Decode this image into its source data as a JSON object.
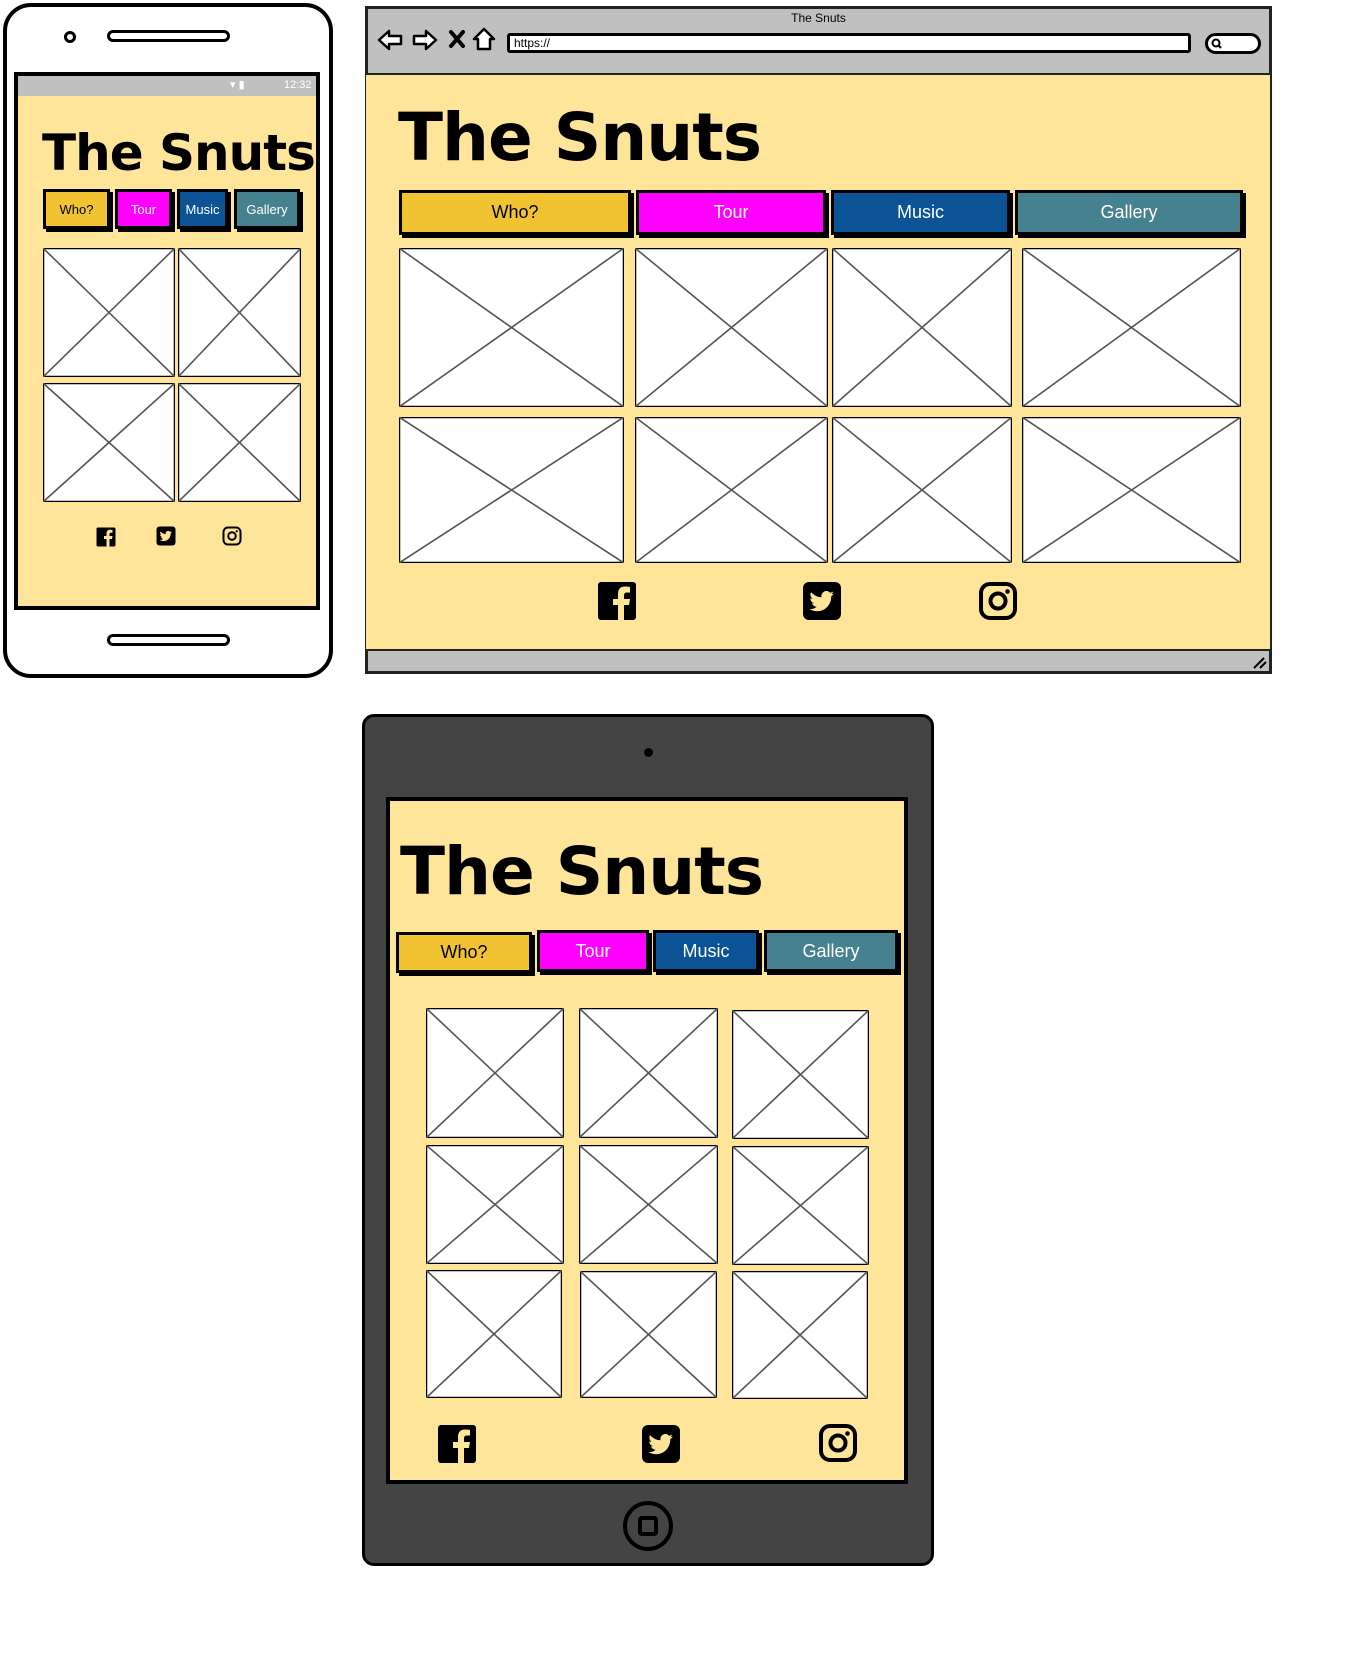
{
  "site": {
    "title": "The Snuts"
  },
  "nav": [
    {
      "label": "Who?",
      "color": "#f1c232"
    },
    {
      "label": "Tour",
      "color": "#ff00ff"
    },
    {
      "label": "Music",
      "color": "#0b5394"
    },
    {
      "label": "Gallery",
      "color": "#45818e"
    }
  ],
  "colors": {
    "page_bg": "#ffe599",
    "browser_chrome": "#c0c0c0",
    "tablet_frame": "#444444"
  },
  "mobile": {
    "status_time": "12:32"
  },
  "browser": {
    "window_title": "The Snuts",
    "url": "https://"
  },
  "social": [
    "facebook-icon",
    "twitter-icon",
    "instagram-icon"
  ]
}
